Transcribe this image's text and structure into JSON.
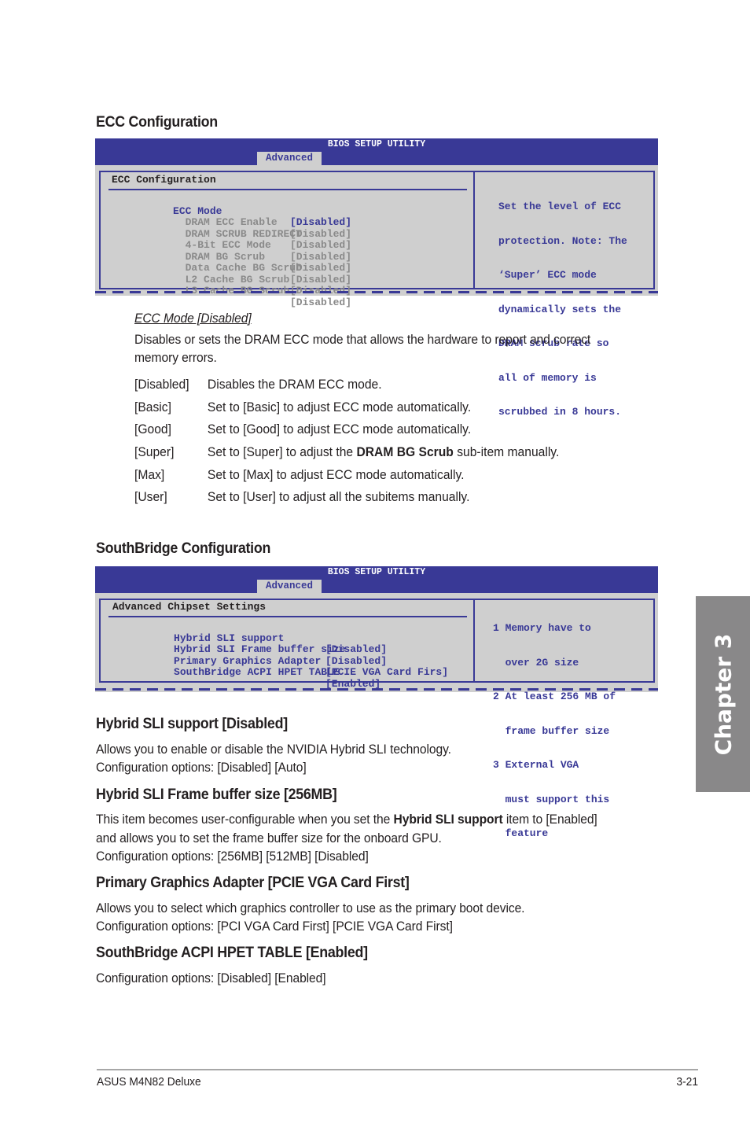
{
  "ecc_section": {
    "title": "ECC Configuration",
    "bios": {
      "header_title": "BIOS SETUP UTILITY",
      "active_tab": "Advanced",
      "panel_title": "ECC Configuration",
      "items": [
        {
          "label": "ECC Mode",
          "value": "[Disabled]",
          "state": "selected"
        },
        {
          "label": "  DRAM ECC Enable",
          "value": "[Disabled]",
          "state": "disabled"
        },
        {
          "label": "  DRAM SCRUB REDIRECT",
          "value": "[Disabled]",
          "state": "disabled"
        },
        {
          "label": "  4-Bit ECC Mode",
          "value": "[Disabled]",
          "state": "disabled"
        },
        {
          "label": "  DRAM BG Scrub",
          "value": "[Disabled]",
          "state": "disabled"
        },
        {
          "label": "  Data Cache BG Scrub",
          "value": "[Disabled]",
          "state": "disabled"
        },
        {
          "label": "  L2 Cache BG Scrub",
          "value": "[Disabled]",
          "state": "disabled"
        },
        {
          "label": "  L3 Cache BG Scrub",
          "value": "[Disabled]",
          "state": "disabled"
        }
      ],
      "help_lines": [
        "Set the level of ECC",
        "protection. Note: The",
        "‘Super’ ECC mode",
        "dynamically sets the",
        "DRAM scrub rate so",
        "all of memory is",
        "scrubbed in 8 hours."
      ]
    },
    "ecc_mode": {
      "heading": "ECC Mode [Disabled]",
      "description_line1": "Disables or sets the DRAM ECC mode that allows the hardware to report and correct",
      "description_line2": "memory errors.",
      "options": [
        {
          "key": "[Disabled]",
          "desc_pre": "Disables the DRAM ECC mode.",
          "desc_bold": "",
          "desc_post": ""
        },
        {
          "key": "[Basic]",
          "desc_pre": "Set to [Basic] to adjust ECC mode automatically.",
          "desc_bold": "",
          "desc_post": ""
        },
        {
          "key": "[Good]",
          "desc_pre": "Set to [Good] to adjust ECC mode automatically.",
          "desc_bold": "",
          "desc_post": ""
        },
        {
          "key": "[Super]",
          "desc_pre": "Set to [Super] to adjust the ",
          "desc_bold": "DRAM BG Scrub",
          "desc_post": " sub-item manually."
        },
        {
          "key": "[Max]",
          "desc_pre": "Set to [Max] to adjust ECC mode automatically.",
          "desc_bold": "",
          "desc_post": ""
        },
        {
          "key": "[User]",
          "desc_pre": "Set to [User] to adjust all the subitems manually.",
          "desc_bold": "",
          "desc_post": ""
        }
      ]
    }
  },
  "southbridge_section": {
    "title": "SouthBridge Configuration",
    "bios": {
      "header_title": "BIOS SETUP UTILITY",
      "active_tab": "Advanced",
      "panel_title": "Advanced Chipset Settings",
      "items": [
        {
          "label": "Hybrid SLI support",
          "value": "[Disabled]"
        },
        {
          "label": "Hybrid SLI Frame buffer size",
          "value": "[Disabled]"
        },
        {
          "label": "Primary Graphics Adapter",
          "value": "[PCIE VGA Card Firs]"
        },
        {
          "label": "SouthBridge ACPI HPET TABLE",
          "value": "[Enabled]"
        }
      ],
      "help_lines": [
        "1 Memory have to",
        "  over 2G size",
        "2 At least 256 MB of",
        "  frame buffer size",
        "3 External VGA",
        "  must support this",
        "  feature"
      ]
    },
    "items": [
      {
        "heading": "Hybrid SLI support [Disabled]",
        "line1": "Allows you to enable or disable the NVIDIA Hybrid SLI technology.",
        "line2": "Configuration options: [Disabled] [Auto]"
      },
      {
        "heading": "Hybrid SLI Frame buffer size [256MB]",
        "line1_pre": "This item becomes user-configurable when you set the ",
        "line1_bold": "Hybrid SLI support",
        "line1_post": " item to [Enabled]",
        "line2": "and allows you to set the frame buffer size for the onboard GPU.",
        "line3": "Configuration options: [256MB] [512MB] [Disabled]"
      },
      {
        "heading": "Primary Graphics Adapter [PCIE VGA Card First]",
        "line1": "Allows you to select which graphics controller to use as the primary boot device.",
        "line2": "Configuration options: [PCI VGA Card First] [PCIE VGA Card First]"
      },
      {
        "heading": "SouthBridge ACPI HPET TABLE [Enabled]",
        "line1": "Configuration options: [Disabled] [Enabled]"
      }
    ]
  },
  "chapter_tab": "Chapter 3",
  "footer": {
    "product": "ASUS M4N82 Deluxe",
    "page": "3-21"
  }
}
